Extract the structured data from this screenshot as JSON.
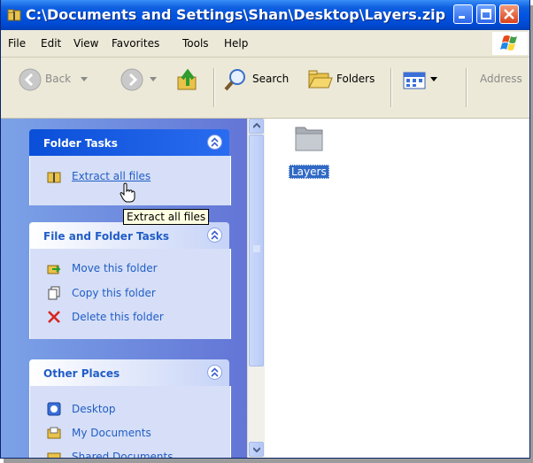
{
  "window": {
    "title": "C:\\Documents and Settings\\Shan\\Desktop\\Layers.zip",
    "icons": [
      "zip-folder-icon",
      "minimize-icon",
      "maximize-icon",
      "close-icon"
    ]
  },
  "menubar": {
    "items": [
      "File",
      "Edit",
      "View",
      "Favorites",
      "Tools",
      "Help"
    ]
  },
  "toolbar": {
    "back_label": "Back",
    "search_label": "Search",
    "folders_label": "Folders",
    "address_label": "Address"
  },
  "taskpane": {
    "folder_tasks": {
      "title": "Folder Tasks",
      "items": [
        "Extract all files"
      ]
    },
    "file_folder_tasks": {
      "title": "File and Folder Tasks",
      "items": [
        "Move this folder",
        "Copy this folder",
        "Delete this folder"
      ]
    },
    "other_places": {
      "title": "Other Places",
      "items": [
        "Desktop",
        "My Documents",
        "Shared Documents"
      ]
    }
  },
  "tooltip": "Extract all files",
  "files": [
    {
      "name": "Layers",
      "icon": "folder-icon",
      "selected": true
    }
  ],
  "colors": {
    "titlebar": "#0053e1",
    "taskpane": "#6f8ee0",
    "link": "#215dc6",
    "selection": "#316ac5"
  }
}
